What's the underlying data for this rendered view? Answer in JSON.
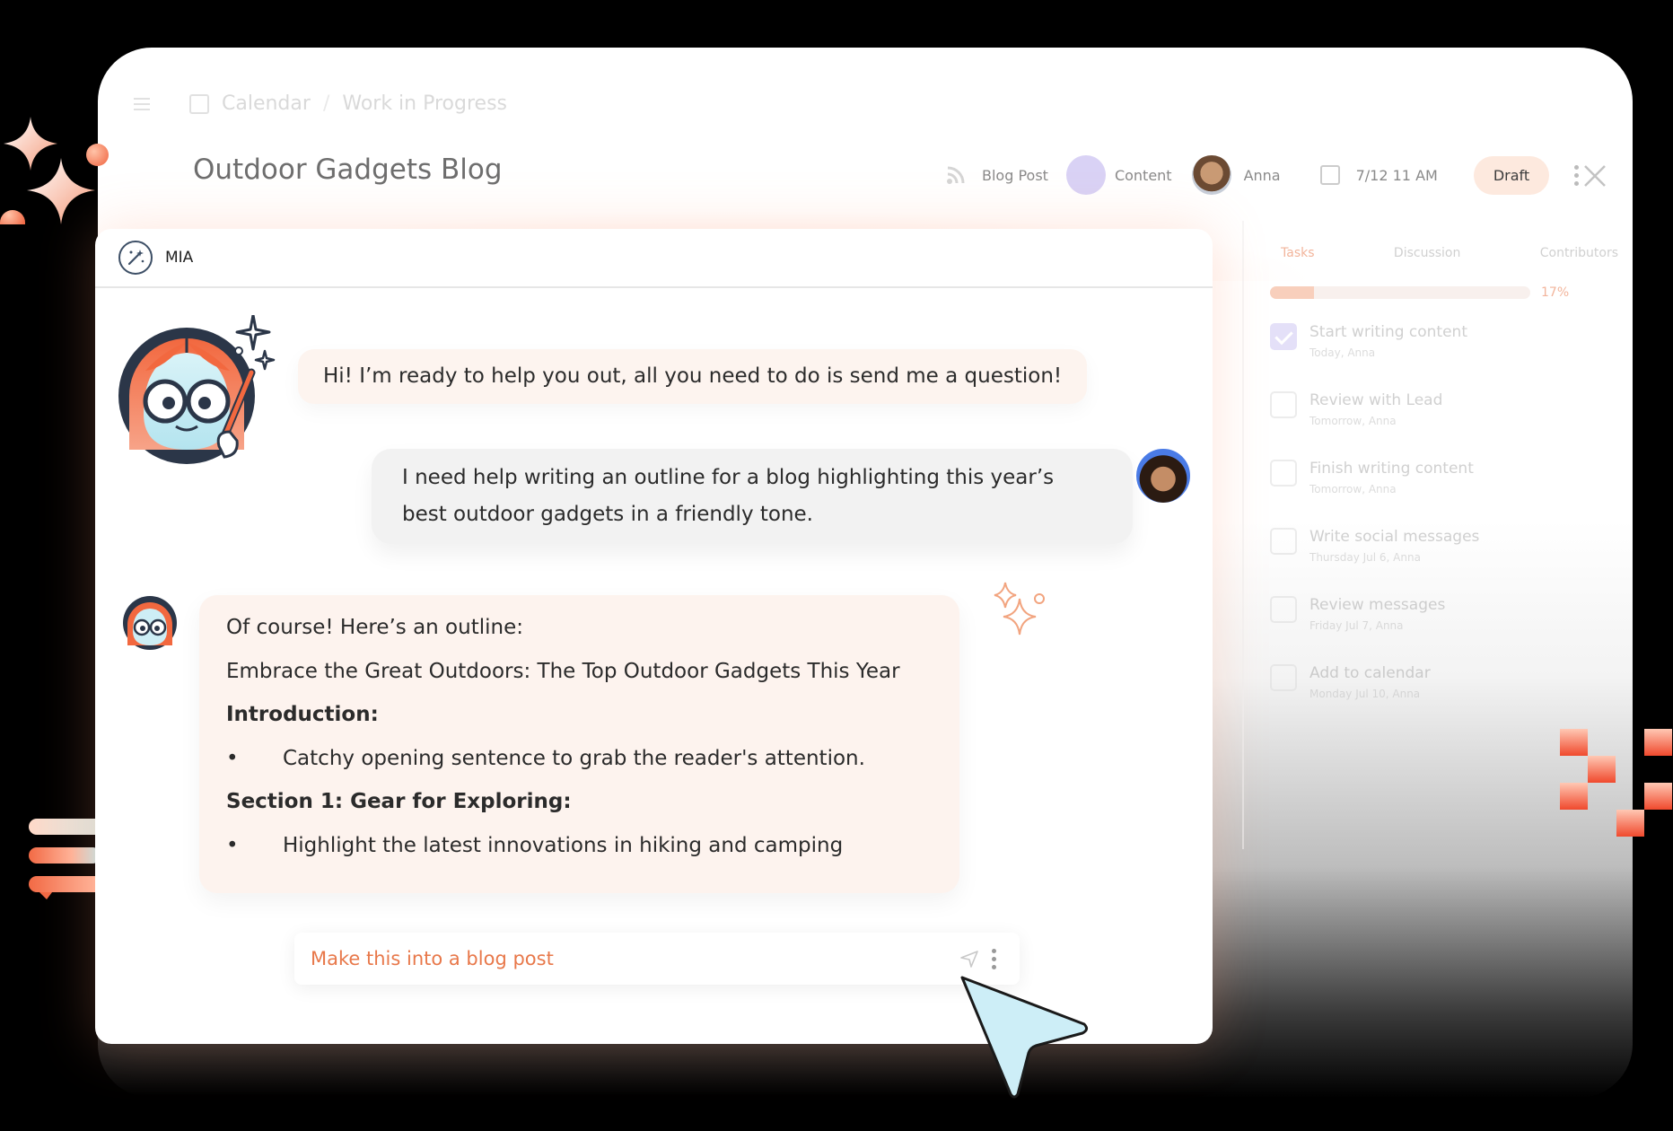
{
  "breadcrumb": {
    "parent": "Calendar",
    "current": "Work in Progress",
    "separator": "/"
  },
  "document": {
    "title": "Outdoor Gadgets Blog",
    "type": "Blog Post",
    "category": "Content",
    "assignee": "Anna",
    "date": "7/12 11 AM",
    "status": "Draft"
  },
  "tasks_panel": {
    "tabs": [
      "Tasks",
      "Discussion",
      "Contributors"
    ],
    "progress": "17%",
    "progress_fraction": 0.17,
    "items": [
      {
        "name": "Start writing content",
        "meta": "Today, Anna",
        "done": true
      },
      {
        "name": "Review with Lead",
        "meta": "Tomorrow, Anna",
        "done": false
      },
      {
        "name": "Finish writing content",
        "meta": "Tomorrow, Anna",
        "done": false
      },
      {
        "name": "Write social messages",
        "meta": "Thursday Jul 6, Anna",
        "done": false
      },
      {
        "name": "Review messages",
        "meta": "Friday Jul 7, Anna",
        "done": false
      },
      {
        "name": "Add to calendar",
        "meta": "Monday Jul 10, Anna",
        "done": false
      }
    ]
  },
  "chat": {
    "title": "MIA",
    "greeting": "Hi! I’m ready to help you out, all you need to do is send me a question!",
    "user_message": "I need help writing an outline for a blog highlighting this year’s best outdoor gadgets in a friendly tone.",
    "response": {
      "intro": "Of course! Here’s an outline:",
      "headline": "Embrace the Great Outdoors: The Top Outdoor Gadgets This Year",
      "section1_title": "Introduction:",
      "section1_bullet": "Catchy opening sentence to grab the reader's attention.",
      "section2_title": "Section 1: Gear for Exploring:",
      "section2_bullet": "Highlight the latest innovations in hiking and camping"
    },
    "input_value": "Make this into a blog post"
  },
  "colors": {
    "accent": "#e8784a",
    "bubble_bot": "#fdf4ef",
    "bubble_user": "#f2f2f2",
    "draft_bg": "#fde9de"
  },
  "icons": [
    "menu-icon",
    "calendar-icon",
    "rss-icon",
    "calendar-icon",
    "kebab-icon",
    "close-icon",
    "magic-wand-icon",
    "send-icon",
    "cursor-icon",
    "sparkle-icon"
  ]
}
